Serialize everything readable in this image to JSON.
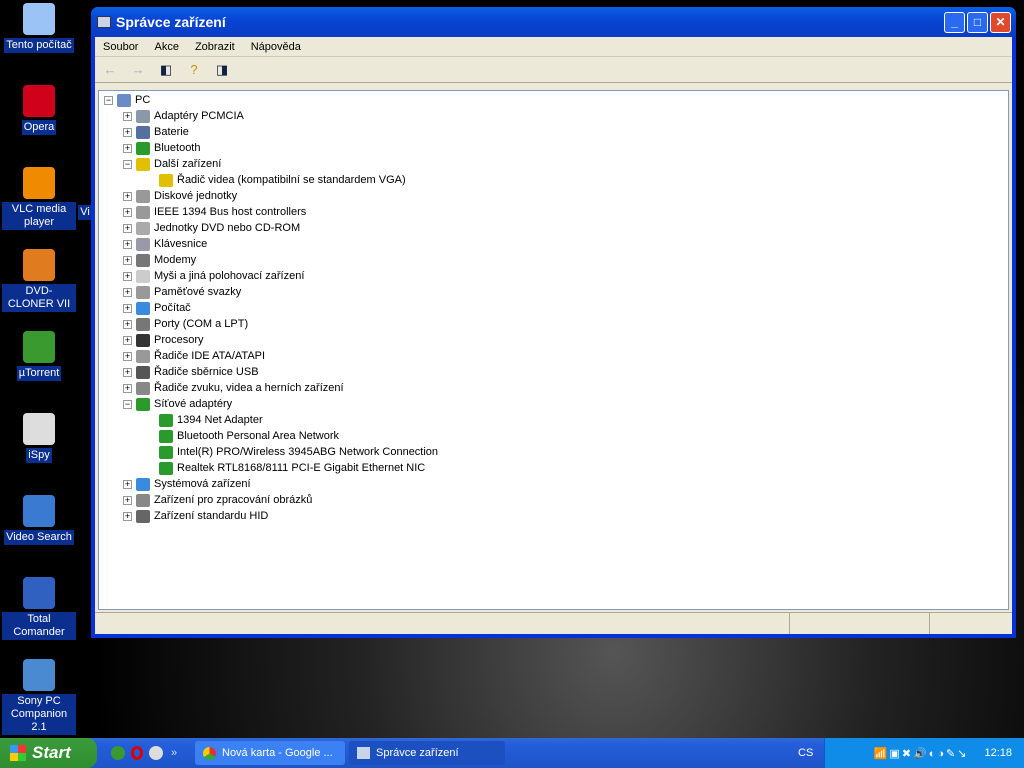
{
  "desktop": {
    "icons": [
      {
        "label": "Tento počítač",
        "color": "#9cc3f5"
      },
      {
        "label": "Opera",
        "color": "#d0021b"
      },
      {
        "label": "VLC media player",
        "color": "#f08a00"
      },
      {
        "label": "DVD-CLONER VII",
        "color": "#e07b20"
      },
      {
        "label": "µTorrent",
        "color": "#3a9a30"
      },
      {
        "label": "iSpy",
        "color": "#ddd"
      },
      {
        "label": "Video Search",
        "color": "#3a7ad0"
      },
      {
        "label": "Total Comander",
        "color": "#3060c0"
      },
      {
        "label": "Sony PC Companion 2.1",
        "color": "#4a8ad0"
      }
    ],
    "partial_label": "Vi"
  },
  "window": {
    "title": "Správce zařízení",
    "menu": [
      "Soubor",
      "Akce",
      "Zobrazit",
      "Nápověda"
    ],
    "tree": {
      "root": "PC",
      "items": [
        {
          "label": "Adaptéry PCMCIA",
          "exp": "+",
          "color": "#8899aa"
        },
        {
          "label": "Baterie",
          "exp": "+",
          "color": "#5570a0"
        },
        {
          "label": "Bluetooth",
          "exp": "+",
          "color": "#2a9a2a"
        },
        {
          "label": "Další zařízení",
          "exp": "−",
          "color": "#e0c000"
        },
        {
          "label": "Řadič videa (kompatibilní se standardem VGA)",
          "child": true,
          "color": "#e0c000"
        },
        {
          "label": "Diskové jednotky",
          "exp": "+",
          "color": "#999"
        },
        {
          "label": "IEEE 1394 Bus host controllers",
          "exp": "+",
          "color": "#999"
        },
        {
          "label": "Jednotky DVD nebo CD-ROM",
          "exp": "+",
          "color": "#aaa"
        },
        {
          "label": "Klávesnice",
          "exp": "+",
          "color": "#99a"
        },
        {
          "label": "Modemy",
          "exp": "+",
          "color": "#777"
        },
        {
          "label": "Myši a jiná polohovací zařízení",
          "exp": "+",
          "color": "#ccc"
        },
        {
          "label": "Paměťové svazky",
          "exp": "+",
          "color": "#999"
        },
        {
          "label": "Počítač",
          "exp": "+",
          "color": "#3a8ae0"
        },
        {
          "label": "Porty (COM a LPT)",
          "exp": "+",
          "color": "#777"
        },
        {
          "label": "Procesory",
          "exp": "+",
          "color": "#333"
        },
        {
          "label": "Řadiče IDE ATA/ATAPI",
          "exp": "+",
          "color": "#999"
        },
        {
          "label": "Řadiče sběrnice USB",
          "exp": "+",
          "color": "#555"
        },
        {
          "label": "Řadiče zvuku, videa a herních zařízení",
          "exp": "+",
          "color": "#888"
        },
        {
          "label": "Síťové adaptéry",
          "exp": "−",
          "color": "#2a9a2a"
        },
        {
          "label": "1394 Net Adapter",
          "child": true,
          "color": "#2a9a2a"
        },
        {
          "label": "Bluetooth Personal Area Network",
          "child": true,
          "color": "#2a9a2a"
        },
        {
          "label": "Intel(R) PRO/Wireless 3945ABG Network Connection",
          "child": true,
          "color": "#2a9a2a"
        },
        {
          "label": "Realtek RTL8168/8111 PCI-E Gigabit Ethernet NIC",
          "child": true,
          "color": "#2a9a2a"
        },
        {
          "label": "Systémová zařízení",
          "exp": "+",
          "color": "#3a8ae0"
        },
        {
          "label": "Zařízení pro zpracování obrázků",
          "exp": "+",
          "color": "#888"
        },
        {
          "label": "Zařízení standardu HID",
          "exp": "+",
          "color": "#666"
        }
      ]
    }
  },
  "taskbar": {
    "start": "Start",
    "tasks": [
      "Nová karta - Google ...",
      "Správce zařízení"
    ],
    "lang": "CS",
    "clock": "12:18"
  }
}
